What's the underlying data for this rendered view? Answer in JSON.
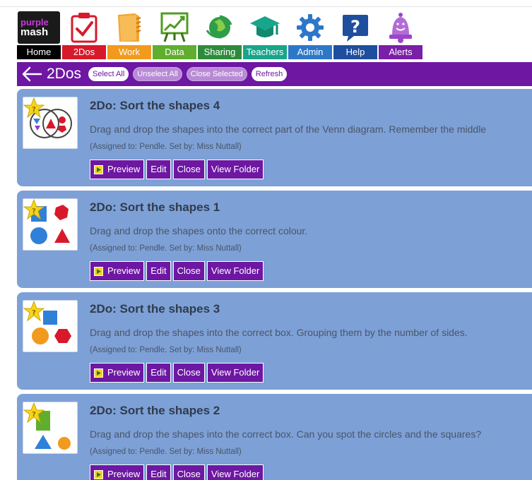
{
  "nav": {
    "items": [
      {
        "label": "Home",
        "color": "#000000"
      },
      {
        "label": "2Dos",
        "color": "#d8192b"
      },
      {
        "label": "Work",
        "color": "#f29a1d"
      },
      {
        "label": "Data",
        "color": "#5fae2d"
      },
      {
        "label": "Sharing",
        "color": "#2d8c3c"
      },
      {
        "label": "Teachers",
        "color": "#18a58a"
      },
      {
        "label": "Admin",
        "color": "#2d77c9"
      },
      {
        "label": "Help",
        "color": "#1e4e9e"
      },
      {
        "label": "Alerts",
        "color": "#7a1fa8"
      }
    ],
    "logo": {
      "line1": "purple",
      "line2": "mash"
    }
  },
  "header": {
    "title": "2Dos",
    "buttons": {
      "select_all": "Select All",
      "unselect_all": "Unselect All",
      "close_selected": "Close Selected",
      "refresh": "Refresh"
    },
    "color": "#6d17a3"
  },
  "actions": {
    "preview": "Preview",
    "edit": "Edit",
    "close": "Close",
    "view_folder": "View Folder"
  },
  "todos": [
    {
      "title": "2Do: Sort the shapes 4",
      "description": "Drag and drop the shapes into the correct part of the Venn diagram. Remember the middle",
      "meta": "(Assigned to: Pendle. Set by: Miss Nuttall)",
      "thumb": "venn-diagram"
    },
    {
      "title": "2Do: Sort the shapes 1",
      "description": "Drag and drop the shapes onto the correct colour.",
      "meta": "(Assigned to: Pendle. Set by: Miss Nuttall)",
      "thumb": "coloured-shapes"
    },
    {
      "title": "2Do: Sort the shapes 3",
      "description": "Drag and drop the shapes into the correct box. Grouping them by the number of sides.",
      "meta": "(Assigned to: Pendle. Set by: Miss Nuttall)",
      "thumb": "sides-shapes"
    },
    {
      "title": "2Do: Sort the shapes 2",
      "description": "Drag and drop the shapes into the correct box. Can you spot the circles and the squares?",
      "meta": "(Assigned to: Pendle. Set by: Miss Nuttall)",
      "thumb": "circles-squares"
    }
  ]
}
